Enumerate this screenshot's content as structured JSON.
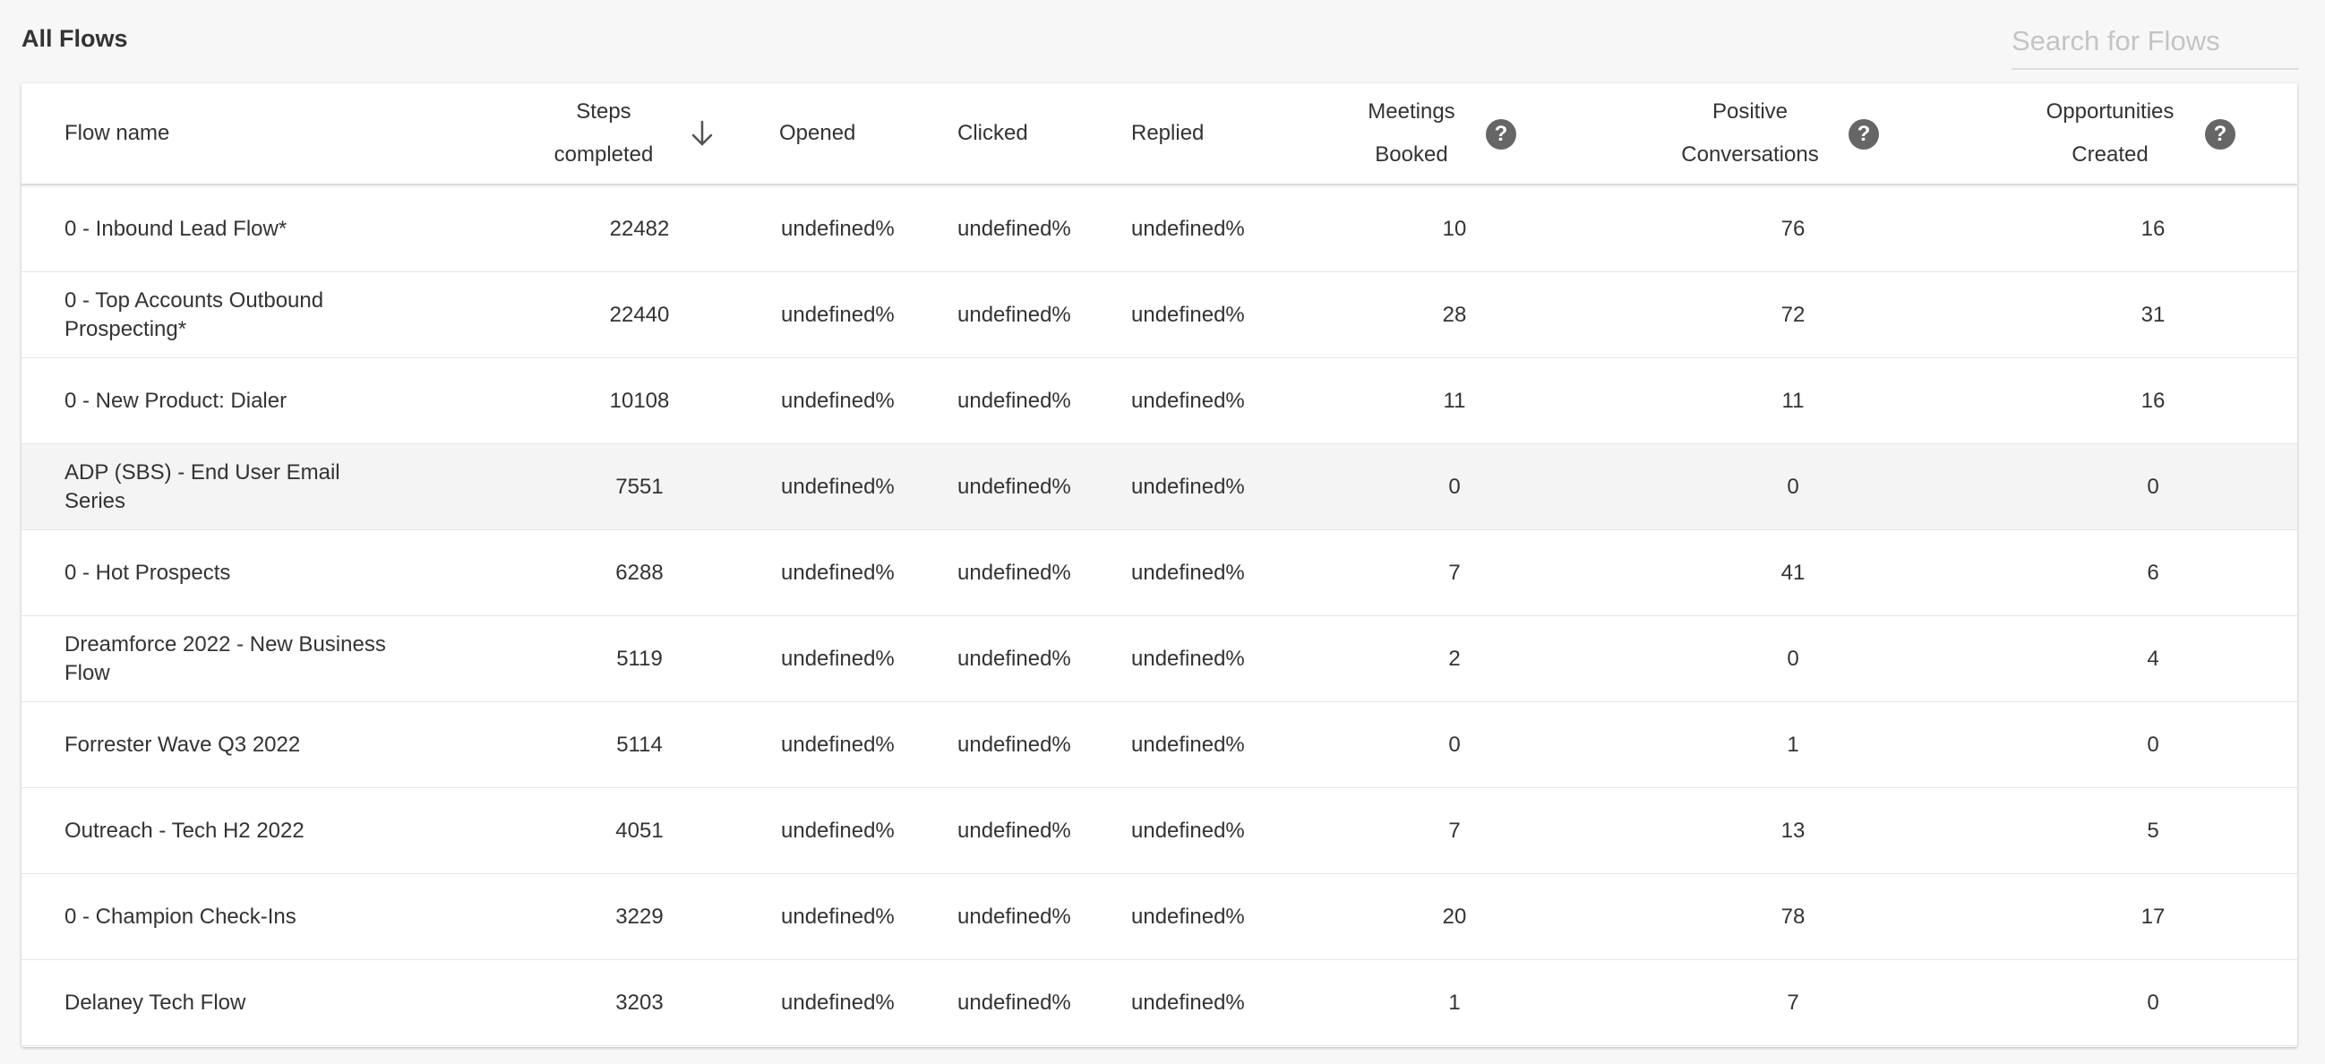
{
  "header": {
    "title": "All Flows",
    "search_placeholder": "Search for Flows",
    "search_value": ""
  },
  "table": {
    "columns": {
      "flow_name": "Flow name",
      "steps_line1": "Steps",
      "steps_line2": "completed",
      "opened": "Opened",
      "clicked": "Clicked",
      "replied": "Replied",
      "meetings_line1": "Meetings",
      "meetings_line2": "Booked",
      "positive_line1": "Positive",
      "positive_line2": "Conversations",
      "opps_line1": "Opportunities",
      "opps_line2": "Created"
    },
    "sort": {
      "column": "Steps completed",
      "direction": "descending",
      "icon": "arrow-down-icon"
    },
    "help_icon": "question-circle-icon",
    "hovered_row_index": 3,
    "rows": [
      {
        "name_line1": "0 - Inbound Lead Flow*",
        "name_line2": "",
        "steps": "22482",
        "opened": "undefined%",
        "clicked": "undefined%",
        "replied": "undefined%",
        "meetings": "10",
        "positive": "76",
        "opps": "16"
      },
      {
        "name_line1": "0 - Top Accounts Outbound",
        "name_line2": "Prospecting*",
        "steps": "22440",
        "opened": "undefined%",
        "clicked": "undefined%",
        "replied": "undefined%",
        "meetings": "28",
        "positive": "72",
        "opps": "31"
      },
      {
        "name_line1": "0 - New Product: Dialer",
        "name_line2": "",
        "steps": "10108",
        "opened": "undefined%",
        "clicked": "undefined%",
        "replied": "undefined%",
        "meetings": "11",
        "positive": "11",
        "opps": "16"
      },
      {
        "name_line1": "ADP (SBS) - End User Email Series",
        "name_line2": "",
        "steps": "7551",
        "opened": "undefined%",
        "clicked": "undefined%",
        "replied": "undefined%",
        "meetings": "0",
        "positive": "0",
        "opps": "0"
      },
      {
        "name_line1": "0 - Hot Prospects",
        "name_line2": "",
        "steps": "6288",
        "opened": "undefined%",
        "clicked": "undefined%",
        "replied": "undefined%",
        "meetings": "7",
        "positive": "41",
        "opps": "6"
      },
      {
        "name_line1": "Dreamforce 2022 - New Business Flow",
        "name_line2": "",
        "steps": "5119",
        "opened": "undefined%",
        "clicked": "undefined%",
        "replied": "undefined%",
        "meetings": "2",
        "positive": "0",
        "opps": "4"
      },
      {
        "name_line1": "Forrester Wave Q3 2022",
        "name_line2": "",
        "steps": "5114",
        "opened": "undefined%",
        "clicked": "undefined%",
        "replied": "undefined%",
        "meetings": "0",
        "positive": "1",
        "opps": "0"
      },
      {
        "name_line1": "Outreach - Tech H2 2022",
        "name_line2": "",
        "steps": "4051",
        "opened": "undefined%",
        "clicked": "undefined%",
        "replied": "undefined%",
        "meetings": "7",
        "positive": "13",
        "opps": "5"
      },
      {
        "name_line1": "0 - Champion Check-Ins",
        "name_line2": "",
        "steps": "3229",
        "opened": "undefined%",
        "clicked": "undefined%",
        "replied": "undefined%",
        "meetings": "20",
        "positive": "78",
        "opps": "17"
      },
      {
        "name_line1": "Delaney Tech Flow",
        "name_line2": "",
        "steps": "3203",
        "opened": "undefined%",
        "clicked": "undefined%",
        "replied": "undefined%",
        "meetings": "1",
        "positive": "7",
        "opps": "0"
      }
    ]
  },
  "colors": {
    "background": "#f7f7f7",
    "card": "#ffffff",
    "text": "#333333",
    "help_icon": "#666666",
    "row_hover": "#f4f4f4",
    "divider": "#e6e6e6"
  }
}
